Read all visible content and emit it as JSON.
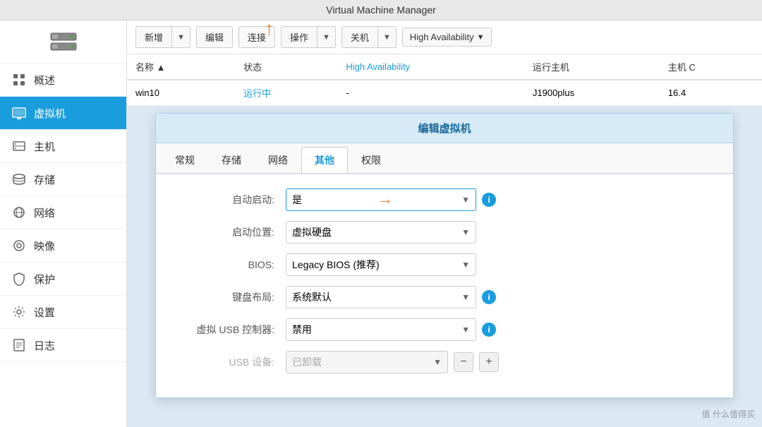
{
  "titleBar": {
    "title": "Virtual Machine Manager"
  },
  "sidebar": {
    "logo": "server-icon",
    "items": [
      {
        "id": "overview",
        "label": "概述",
        "icon": "overview-icon",
        "active": false
      },
      {
        "id": "vm",
        "label": "虚拟机",
        "icon": "vm-icon",
        "active": true
      },
      {
        "id": "host",
        "label": "主机",
        "icon": "host-icon",
        "active": false
      },
      {
        "id": "storage",
        "label": "存储",
        "icon": "storage-icon",
        "active": false
      },
      {
        "id": "network",
        "label": "网络",
        "icon": "network-icon",
        "active": false
      },
      {
        "id": "image",
        "label": "映像",
        "icon": "image-icon",
        "active": false
      },
      {
        "id": "protection",
        "label": "保护",
        "icon": "protection-icon",
        "active": false
      },
      {
        "id": "settings",
        "label": "设置",
        "icon": "settings-icon",
        "active": false
      },
      {
        "id": "logs",
        "label": "日志",
        "icon": "logs-icon",
        "active": false
      }
    ]
  },
  "toolbar": {
    "newBtn": "新增",
    "editBtn": "编辑",
    "connectBtn": "连接",
    "operateBtn": "操作",
    "shutdownBtn": "关机",
    "haBtn": "High Availability"
  },
  "table": {
    "columns": [
      "名称 ▲",
      "状态",
      "High Availability",
      "运行主机",
      "主机 C"
    ],
    "rows": [
      {
        "name": "win10",
        "status": "运行中",
        "ha": "-",
        "host": "J1900plus",
        "cpu": "16.4"
      }
    ]
  },
  "dialog": {
    "title": "编辑虚拟机",
    "tabs": [
      "常规",
      "存储",
      "网络",
      "其他",
      "权限"
    ],
    "activeTab": "其他",
    "fields": [
      {
        "label": "自动启动:",
        "value": "是",
        "type": "select",
        "disabled": false,
        "hasInfo": true
      },
      {
        "label": "启动位置:",
        "value": "虚拟硬盘",
        "type": "select",
        "disabled": false,
        "hasInfo": false
      },
      {
        "label": "BIOS:",
        "value": "Legacy BIOS (推荐)",
        "type": "select",
        "disabled": false,
        "hasInfo": false
      },
      {
        "label": "键盘布局:",
        "value": "系统默认",
        "type": "select",
        "disabled": false,
        "hasInfo": true
      },
      {
        "label": "虚拟 USB 控制器:",
        "value": "禁用",
        "type": "select",
        "disabled": false,
        "hasInfo": true
      },
      {
        "label": "USB 设备:",
        "value": "已卸载",
        "type": "select",
        "disabled": true,
        "hasInfo": false,
        "hasUsbControls": true
      }
    ]
  },
  "watermark": "值 什么值得买"
}
